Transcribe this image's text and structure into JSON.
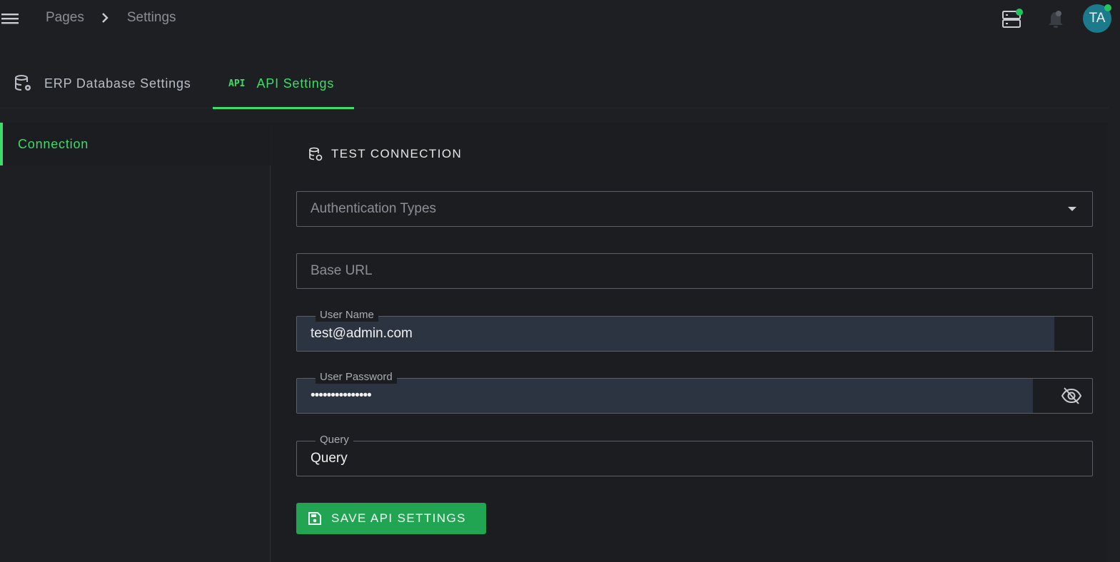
{
  "breadcrumb": {
    "items": [
      "Pages",
      "Settings"
    ]
  },
  "header": {
    "avatar_initials": "TA"
  },
  "tabs": [
    {
      "label": "ERP Database Settings",
      "icon": "database-settings-icon"
    },
    {
      "label": "API Settings",
      "icon": "api-icon",
      "active": true,
      "icon_text": "API"
    }
  ],
  "sidebar": {
    "items": [
      {
        "label": "Connection",
        "active": true
      }
    ]
  },
  "main": {
    "test_connection_label": "TEST CONNECTION",
    "fields": {
      "auth_types": {
        "placeholder": "Authentication Types"
      },
      "base_url": {
        "placeholder": "Base URL"
      },
      "user_name": {
        "label": "User Name",
        "value": "test@admin.com"
      },
      "user_password": {
        "label": "User Password",
        "value": "•••••••••••••••"
      },
      "query": {
        "label": "Query",
        "value": "Query"
      }
    },
    "save_label": "SAVE API SETTINGS"
  },
  "colors": {
    "accent": "#3ddc6a",
    "save_button": "#22a552",
    "avatar": "#1b7a8c",
    "status_online": "#22c55e"
  }
}
